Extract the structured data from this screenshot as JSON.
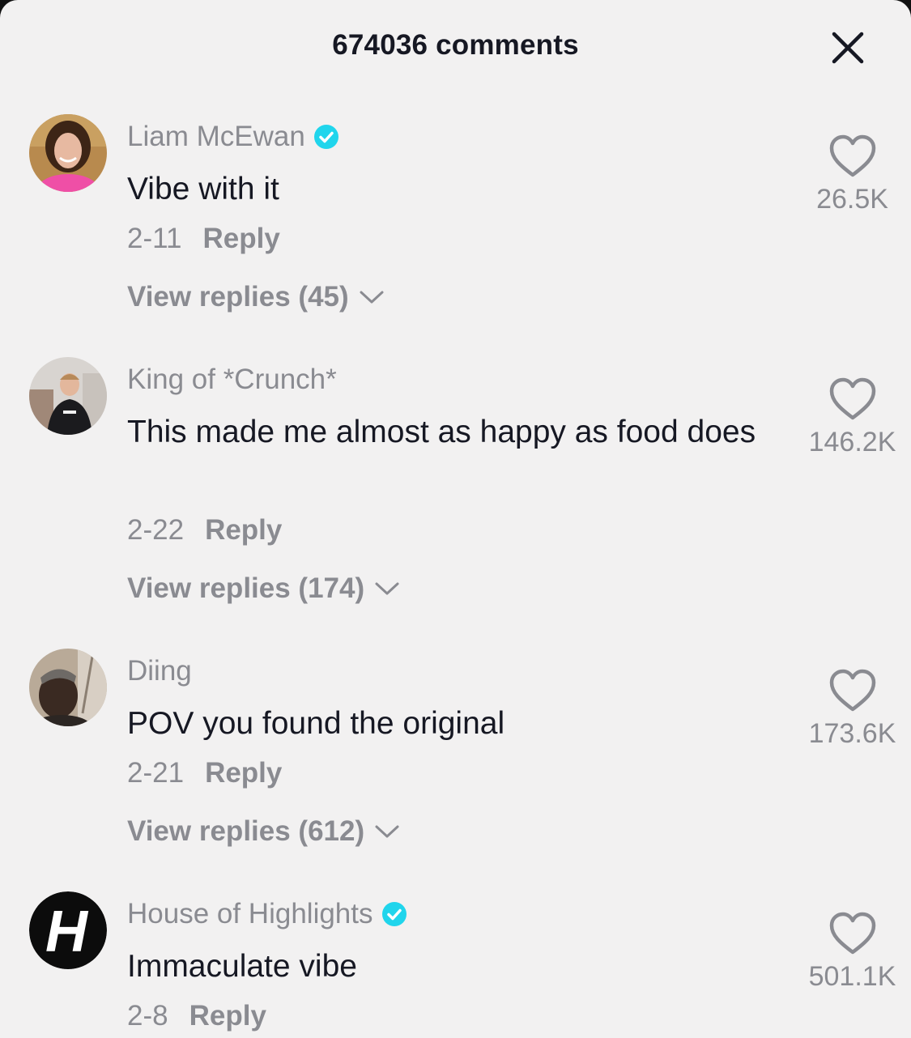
{
  "header": {
    "title": "674036 comments",
    "close_icon": "close-icon"
  },
  "comments": [
    {
      "username": "Liam McEwan",
      "verified": true,
      "text": "Vibe with it",
      "date": "2-11",
      "reply_label": "Reply",
      "view_replies": "View replies (45)",
      "likes": "26.5K",
      "avatar_icon": "avatar-photo"
    },
    {
      "username": "King of *Crunch*",
      "verified": false,
      "text": "This made me almost as happy as food does",
      "date": "2-22",
      "reply_label": "Reply",
      "view_replies": "View replies (174)",
      "likes": "146.2K",
      "avatar_icon": "avatar-photo"
    },
    {
      "username": "Diing",
      "verified": false,
      "text": "POV you found the original",
      "date": "2-21",
      "reply_label": "Reply",
      "view_replies": "View replies (612)",
      "likes": "173.6K",
      "avatar_icon": "avatar-photo"
    },
    {
      "username": "House of Highlights",
      "verified": true,
      "text": "Immaculate vibe",
      "date": "2-8",
      "reply_label": "Reply",
      "likes": "501.1K",
      "avatar_icon": "avatar-logo",
      "avatar_logo_text": "H"
    }
  ],
  "colors": {
    "background": "#f2f1f1",
    "primary_text": "#161823",
    "secondary_text": "#8a8b91",
    "verified_badge": "#20d5ec"
  }
}
